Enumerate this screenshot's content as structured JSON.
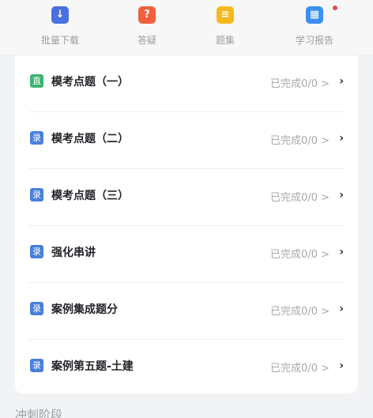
{
  "toolbar": {
    "items": [
      {
        "label": "批量下载",
        "icon": "download-icon",
        "color": "#4a6fe0",
        "glyph": "↓"
      },
      {
        "label": "答疑",
        "icon": "question-icon",
        "color": "#f0603c",
        "glyph": "?"
      },
      {
        "label": "题集",
        "icon": "document-icon",
        "color": "#f5b820",
        "glyph": "≡"
      },
      {
        "label": "学习报告",
        "icon": "report-chart-icon",
        "color": "#3a8ff0",
        "glyph": "▦",
        "has_notification": true
      }
    ]
  },
  "lessons": [
    {
      "tag": "直",
      "tag_type": "live",
      "title": "模考点题（一）",
      "status": "已完成0/0 >"
    },
    {
      "tag": "录",
      "tag_type": "recorded",
      "title": "模考点题（二）",
      "status": "已完成0/0 >"
    },
    {
      "tag": "录",
      "tag_type": "recorded",
      "title": "模考点题（三）",
      "status": "已完成0/0 >"
    },
    {
      "tag": "录",
      "tag_type": "recorded",
      "title": "强化串讲",
      "status": "已完成0/0 >"
    },
    {
      "tag": "录",
      "tag_type": "recorded",
      "title": "案例集成题分",
      "status": "已完成0/0 >"
    },
    {
      "tag": "录",
      "tag_type": "recorded",
      "title": "案例第五题-土建",
      "status": "已完成0/0 >"
    }
  ],
  "next_section": {
    "title": "冲刺阶段"
  },
  "colors": {
    "live_tag": "#3cb371",
    "recorded_tag": "#4a7fd9",
    "notification": "#e84848"
  }
}
